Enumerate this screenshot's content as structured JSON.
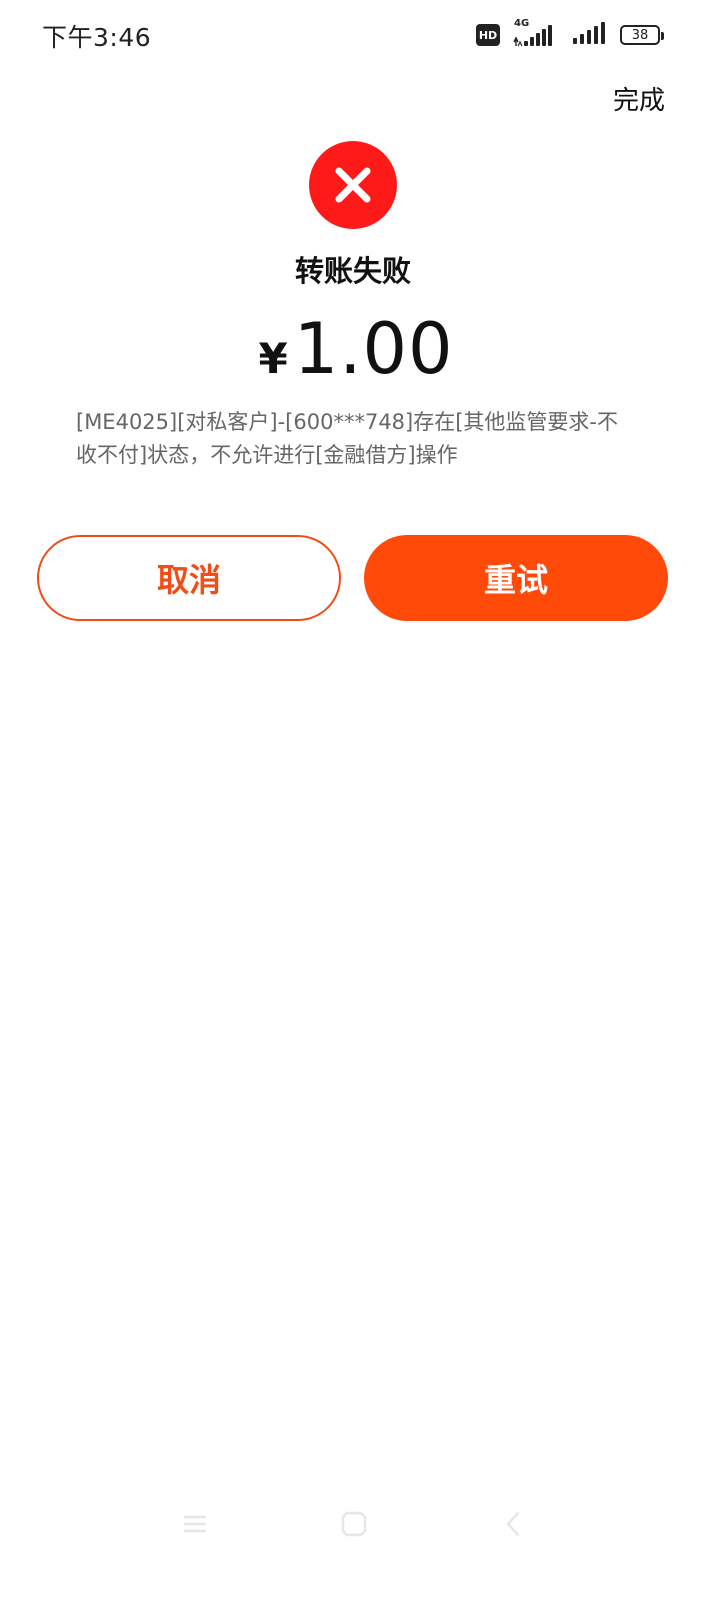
{
  "status_bar": {
    "time": "下午3:46",
    "hd_label": "HD",
    "network_label": "4G",
    "battery_level": "38",
    "icons": [
      "hd-icon",
      "signal-icon",
      "signal-icon",
      "battery-icon"
    ]
  },
  "header": {
    "done_label": "完成"
  },
  "result": {
    "status_icon": "close-icon",
    "status_color": "#ff1a1a",
    "title": "转账失败",
    "currency_symbol": "¥",
    "amount": "1.00",
    "message": "[ME4025][对私客户]-[600***748]存在[其他监管要求-不收不付]状态，不允许进行[金融借方]操作"
  },
  "actions": {
    "cancel_label": "取消",
    "retry_label": "重试",
    "accent_color": "#ff4a0a"
  },
  "nav_bar": {
    "icons": [
      "menu-icon",
      "home-icon",
      "back-icon"
    ]
  }
}
